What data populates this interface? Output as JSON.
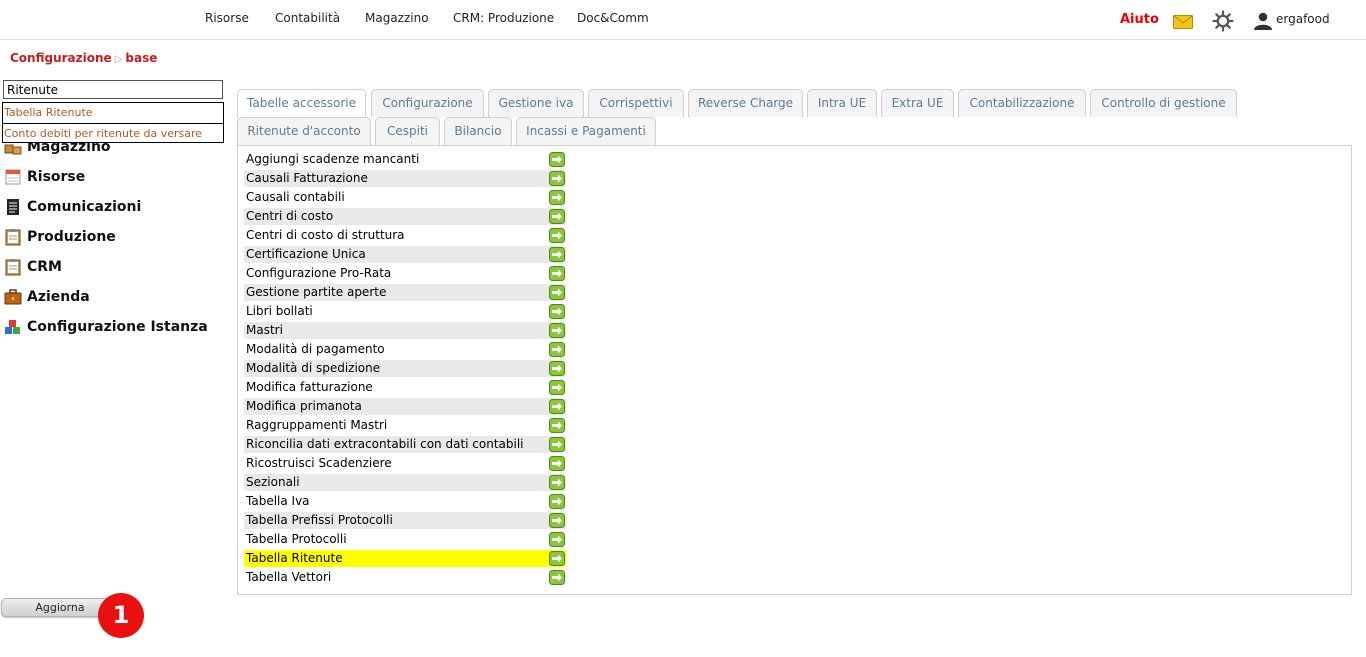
{
  "top_nav": {
    "items": [
      "Risorse",
      "Contabilità",
      "Magazzino",
      "CRM: Produzione",
      "Doc&Comm"
    ],
    "help": "Aiuto",
    "user": "ergafood"
  },
  "breadcrumb": {
    "items": [
      "Configurazione",
      "base"
    ],
    "separator": "▷"
  },
  "search": {
    "value": "Ritenute",
    "suggestions": [
      "Tabella Ritenute",
      "Conto debiti per ritenute da versare"
    ]
  },
  "sidebar": {
    "items": [
      {
        "label": "Magazzino",
        "icon": "boxes-icon"
      },
      {
        "label": "Risorse",
        "icon": "calendar-icon"
      },
      {
        "label": "Comunicazioni",
        "icon": "document-icon"
      },
      {
        "label": "Produzione",
        "icon": "clipboard-icon"
      },
      {
        "label": "CRM",
        "icon": "clipboard-icon"
      },
      {
        "label": "Azienda",
        "icon": "briefcase-icon"
      },
      {
        "label": "Configurazione Istanza",
        "icon": "blocks-icon"
      }
    ]
  },
  "refresh_button": "Aggiorna",
  "step_badge": "1",
  "tabs": {
    "row1": [
      "Tabelle accessorie",
      "Configurazione",
      "Gestione iva",
      "Corrispettivi",
      "Reverse Charge",
      "Intra UE",
      "Extra UE",
      "Contabilizzazione",
      "Controllo di gestione"
    ],
    "row2": [
      "Ritenute d'acconto",
      "Cespiti",
      "Bilancio",
      "Incassi e Pagamenti"
    ],
    "active": "Tabelle accessorie"
  },
  "rows": [
    "Aggiungi scadenze mancanti",
    "Causali Fatturazione",
    "Causali contabili",
    "Centri di costo",
    "Centri di costo di struttura",
    "Certificazione Unica",
    "Configurazione Pro-Rata",
    "Gestione partite aperte",
    "Libri bollati",
    "Mastri",
    "Modalità di pagamento",
    "Modalità di spedizione",
    "Modifica fatturazione",
    "Modifica primanota",
    "Raggruppamenti Mastri",
    "Riconcilia dati extracontabili con dati contabili",
    "Ricostruisci Scadenziere",
    "Sezionali",
    "Tabella Iva",
    "Tabella Prefissi Protocolli",
    "Tabella Protocolli",
    "Tabella Ritenute",
    "Tabella Vettori"
  ],
  "highlighted_row": "Tabella Ritenute",
  "colors": {
    "accent_red": "#c81d1d",
    "highlight": "#ffff00",
    "tab_text": "#5b7c95",
    "go_green": "#8cc63f"
  }
}
